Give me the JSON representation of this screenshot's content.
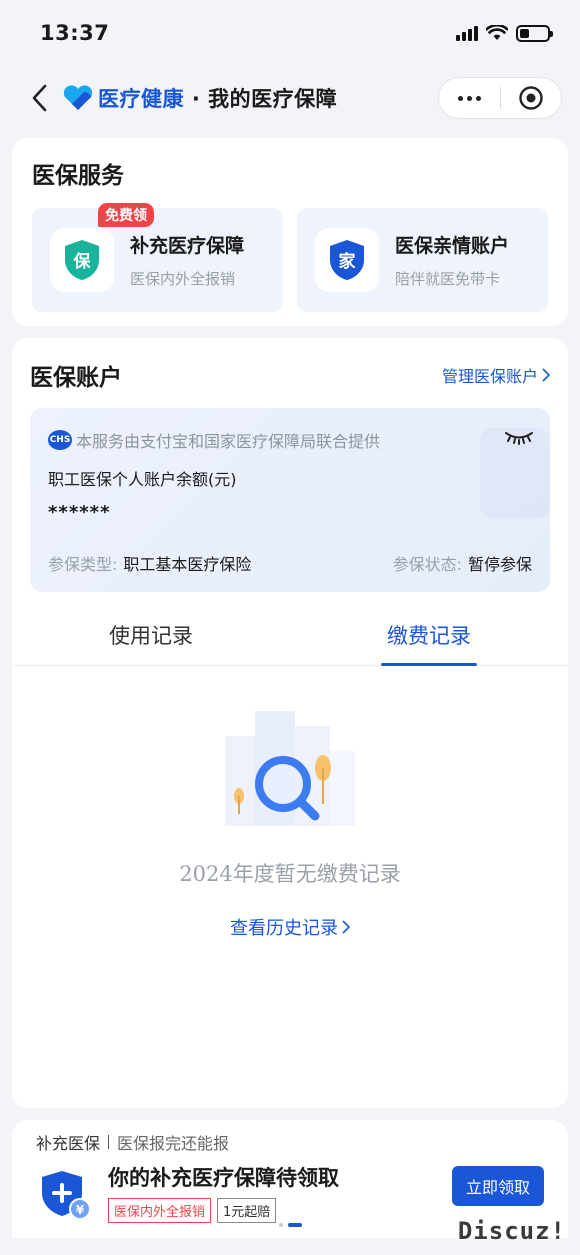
{
  "status_bar": {
    "time": "13:37",
    "battery_level": 0.35
  },
  "nav": {
    "brand": "医疗健康",
    "separator": "·",
    "title": "我的医疗保障"
  },
  "services": {
    "title": "医保服务",
    "items": [
      {
        "icon_char": "保",
        "icon_color": "#19b29a",
        "title": "补充医疗保障",
        "subtitle": "医保内外全报销",
        "badge": "免费领"
      },
      {
        "icon_char": "家",
        "icon_color": "#1a57d6",
        "title": "医保亲情账户",
        "subtitle": "陪伴就医免带卡"
      }
    ]
  },
  "account": {
    "title": "医保账户",
    "manage_link": "管理医保账户",
    "provider_logo": "CHS",
    "provider_text": "本服务由支付宝和国家医疗保障局联合提供",
    "balance_label": "职工医保个人账户余额(元)",
    "balance_value": "******",
    "type_key": "参保类型:",
    "type_value": "职工基本医疗保险",
    "state_key": "参保状态:",
    "state_value": "暂停参保"
  },
  "tabs": [
    {
      "label": "使用记录",
      "active": false
    },
    {
      "label": "缴费记录",
      "active": true
    }
  ],
  "empty_state": {
    "text": "2024年度暂无缴费记录",
    "history_link": "查看历史记录"
  },
  "promo": {
    "label": "补充医保",
    "sub": "医保报完还能报",
    "title": "你的补充医疗保障待领取",
    "tag1": "医保内外全报销",
    "tag2": "1元起赔",
    "button": "立即领取"
  },
  "watermark_text": "Discuz!",
  "colors": {
    "accent": "#1a57d6",
    "badge_red": "#f0434a",
    "teal": "#19b29a"
  }
}
